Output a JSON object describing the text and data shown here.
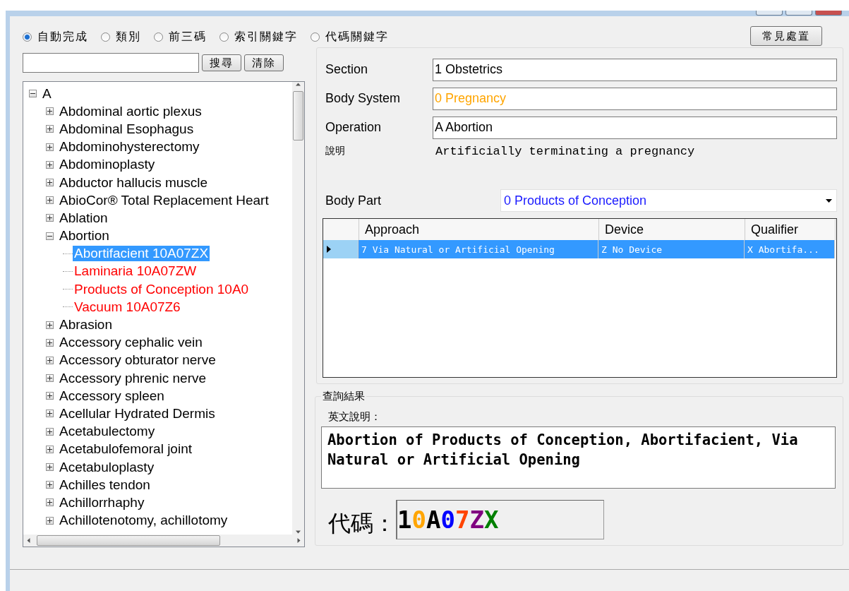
{
  "search_modes": [
    {
      "label": "自動完成",
      "selected": true
    },
    {
      "label": "類別",
      "selected": false
    },
    {
      "label": "前三碼",
      "selected": false
    },
    {
      "label": "索引關鍵字",
      "selected": false
    },
    {
      "label": "代碼關鍵字",
      "selected": false
    }
  ],
  "common_button": "常見處置",
  "search": {
    "buttons": [
      "搜尋",
      "清除"
    ]
  },
  "tree": [
    {
      "label": "A",
      "expanded": true,
      "children": [
        {
          "label": "Abdominal aortic plexus",
          "expanded": false
        },
        {
          "label": "Abdominal Esophagus",
          "expanded": false
        },
        {
          "label": "Abdominohysterectomy",
          "expanded": false
        },
        {
          "label": "Abdominoplasty",
          "expanded": false
        },
        {
          "label": "Abductor hallucis muscle",
          "expanded": false
        },
        {
          "label": "AbioCor® Total Replacement Heart",
          "expanded": false
        },
        {
          "label": "Ablation",
          "expanded": false
        },
        {
          "label": "Abortion",
          "expanded": true,
          "children": [
            {
              "label": "Abortifacient 10A07ZX",
              "kind": "code",
              "selected": true
            },
            {
              "label": "Laminaria 10A07ZW",
              "kind": "code",
              "selected": false
            },
            {
              "label": "Products of Conception 10A0",
              "kind": "code",
              "selected": false
            },
            {
              "label": "Vacuum 10A07Z6",
              "kind": "code",
              "selected": false
            }
          ]
        },
        {
          "label": "Abrasion",
          "expanded": false
        },
        {
          "label": "Accessory cephalic vein",
          "expanded": false
        },
        {
          "label": "Accessory obturator nerve",
          "expanded": false
        },
        {
          "label": "Accessory phrenic nerve",
          "expanded": false
        },
        {
          "label": "Accessory spleen",
          "expanded": false
        },
        {
          "label": "Acellular Hydrated Dermis",
          "expanded": false
        },
        {
          "label": "Acetabulectomy",
          "expanded": false
        },
        {
          "label": "Acetabulofemoral joint",
          "expanded": false
        },
        {
          "label": "Acetabuloplasty",
          "expanded": false
        },
        {
          "label": "Achilles tendon",
          "expanded": false
        },
        {
          "label": "Achillorrhaphy",
          "expanded": false
        },
        {
          "label": "Achillotenotomy, achillotomy",
          "expanded": false
        }
      ]
    }
  ],
  "fields": [
    {
      "label": "Section",
      "value": "1 Obstetrics",
      "color": "#000000"
    },
    {
      "label": "Body System",
      "value": "0 Pregnancy",
      "color": "#ffa500"
    },
    {
      "label": "Operation",
      "value": "A Abortion",
      "color": "#000000"
    }
  ],
  "description": {
    "label": "說明",
    "value": "Artificially terminating a pregnancy"
  },
  "body_part": {
    "label": "Body Part",
    "value": "0 Products of Conception"
  },
  "grid": {
    "columns": [
      "Approach",
      "Device",
      "Qualifier"
    ],
    "rows": [
      {
        "cells": [
          "7 Via Natural or Artificial Opening",
          "Z No Device",
          "X Abortifa..."
        ],
        "selected": true
      }
    ]
  },
  "result": {
    "title": "查詢結果",
    "english_label": "英文說明：",
    "english_text": "Abortion of Products of Conception, Abortifacient, Via Natural or Artificial Opening",
    "code_label": "代碼：",
    "code_chars": [
      {
        "char": "1",
        "color": "#000000"
      },
      {
        "char": "0",
        "color": "#ffa500"
      },
      {
        "char": "A",
        "color": "#000000"
      },
      {
        "char": "0",
        "color": "#0000ff"
      },
      {
        "char": "7",
        "color": "#ff4500"
      },
      {
        "char": "Z",
        "color": "#800080"
      },
      {
        "char": "X",
        "color": "#008000"
      }
    ]
  }
}
